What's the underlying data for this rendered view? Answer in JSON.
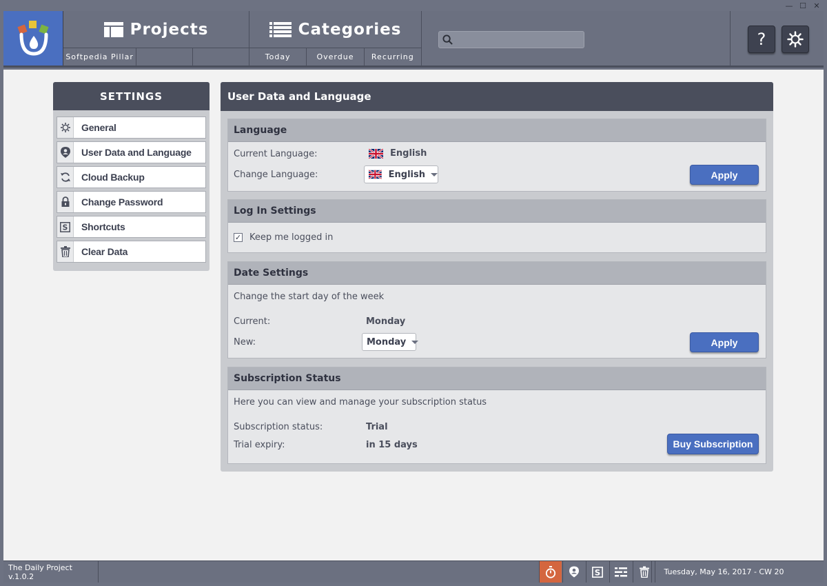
{
  "window": {
    "controls": [
      "—",
      "☐",
      "✕"
    ]
  },
  "header": {
    "projects": {
      "label": "Projects",
      "subtabs": [
        "Softpedia Pillar",
        "",
        ""
      ]
    },
    "categories": {
      "label": "Categories",
      "subtabs": [
        "Today",
        "Overdue",
        "Recurring"
      ]
    },
    "search": {
      "placeholder": ""
    },
    "help_label": "?",
    "logo_colors": [
      "#d4663f",
      "#e8c43a",
      "#7cb342"
    ]
  },
  "settings": {
    "title": "SETTINGS",
    "items": [
      {
        "label": "General",
        "icon": "gear-icon"
      },
      {
        "label": "User Data and Language",
        "icon": "user-pin-icon"
      },
      {
        "label": "Cloud Backup",
        "icon": "sync-icon"
      },
      {
        "label": "Change Password",
        "icon": "lock-icon"
      },
      {
        "label": "Shortcuts",
        "icon": "shortcut-s-icon"
      },
      {
        "label": "Clear Data",
        "icon": "trash-icon"
      }
    ]
  },
  "content": {
    "title": "User Data and Language",
    "language": {
      "heading": "Language",
      "current_label": "Current Language:",
      "current_value": "English",
      "change_label": "Change Language:",
      "change_value": "English",
      "apply": "Apply"
    },
    "login": {
      "heading": "Log In Settings",
      "keep_logged": "Keep me logged in",
      "checked": true
    },
    "date": {
      "heading": "Date Settings",
      "description": "Change the start day of the week",
      "current_label": "Current:",
      "current_value": "Monday",
      "new_label": "New:",
      "new_value": "Monday",
      "apply": "Apply"
    },
    "subscription": {
      "heading": "Subscription Status",
      "description": "Here you can view and manage your subscription status",
      "status_label": "Subscription status:",
      "status_value": "Trial",
      "expiry_label": "Trial expiry:",
      "expiry_value": "in 15 days",
      "buy": "Buy Subscription"
    }
  },
  "footer": {
    "version": "The Daily Project v.1.0.2",
    "date": "Tuesday, May 16, 2017 - CW 20",
    "active_color": "#d4663f"
  },
  "colors": {
    "accent": "#4a6fc0",
    "dark": "#4a4e5c",
    "header": "#6b7080"
  }
}
